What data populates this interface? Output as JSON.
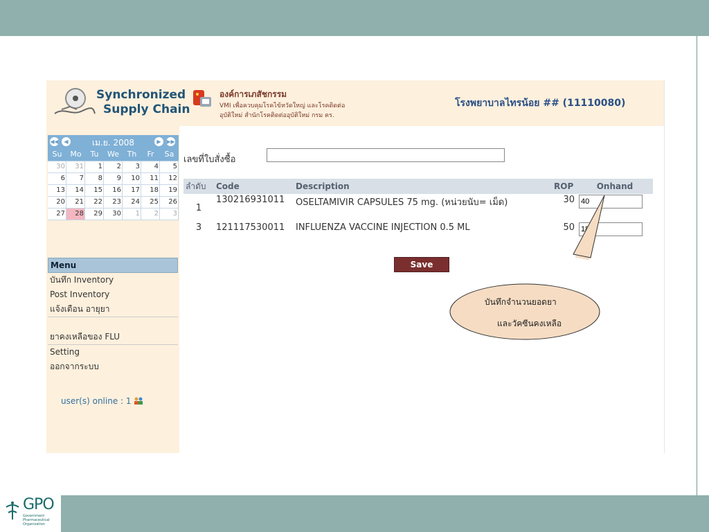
{
  "header": {
    "brand_line1": "Synchronized",
    "brand_line2": "Supply Chain",
    "org_name": "องค์การเภสัชกรรม",
    "org_sub1": "VMI เพื่อควบคุมโรคไข้หวัดใหญ่ และโรคติดต่อ",
    "org_sub2": "อุบัติใหม่ สำนักโรคติดต่ออุบัติใหม่ กรม คร.",
    "hospital": "โรงพยาบาลไทรน้อย ## (11110080)"
  },
  "calendar": {
    "title": "เม.ย. 2008",
    "days": [
      "Su",
      "Mo",
      "Tu",
      "We",
      "Th",
      "Fr",
      "Sa"
    ],
    "weeks": [
      [
        "30",
        "31",
        "1",
        "2",
        "3",
        "4",
        "5"
      ],
      [
        "6",
        "7",
        "8",
        "9",
        "10",
        "11",
        "12"
      ],
      [
        "13",
        "14",
        "15",
        "16",
        "17",
        "18",
        "19"
      ],
      [
        "20",
        "21",
        "22",
        "23",
        "24",
        "25",
        "26"
      ],
      [
        "27",
        "28",
        "29",
        "30",
        "1",
        "2",
        "3"
      ]
    ],
    "today": "28"
  },
  "menu": {
    "title": "Menu",
    "items": [
      "บันทึก Inventory",
      "Post Inventory",
      "แจ้งเตือน อายุยา",
      "ยาคงเหลือของ FLU",
      "Setting",
      "ออกจากระบบ"
    ]
  },
  "online": "user(s) online : 1",
  "form": {
    "po_label": "เลขที่ใบสั่งซื้อ",
    "po_value": "",
    "columns": [
      "ลำดับ",
      "Code",
      "Description",
      "ROP",
      "Onhand"
    ],
    "rows": [
      {
        "no": "1",
        "code": "130216931011",
        "description": "OSELTAMIVIR CAPSULES 75 mg. (หน่วยนับ= เม็ด)",
        "rop": "30",
        "onhand": "40"
      },
      {
        "no": "3",
        "code": "121117530011",
        "description": "INFLUENZA VACCINE INJECTION 0.5 ML",
        "rop": "50",
        "onhand": "180"
      }
    ],
    "save_label": "Save"
  },
  "callout": {
    "line1": "บันทึกจำนวนยอดยา",
    "line2": "และวัคซีนคงเหลือ"
  },
  "footer": {
    "logo_text": "GPO",
    "logo_sub": "Government Pharmaceutical Organization"
  },
  "colors": {
    "accent_bar": "#8fb0ad",
    "header_bg": "#fdf0dd",
    "save_button": "#7b2e2e",
    "callout_fill": "#f5dcc3"
  }
}
